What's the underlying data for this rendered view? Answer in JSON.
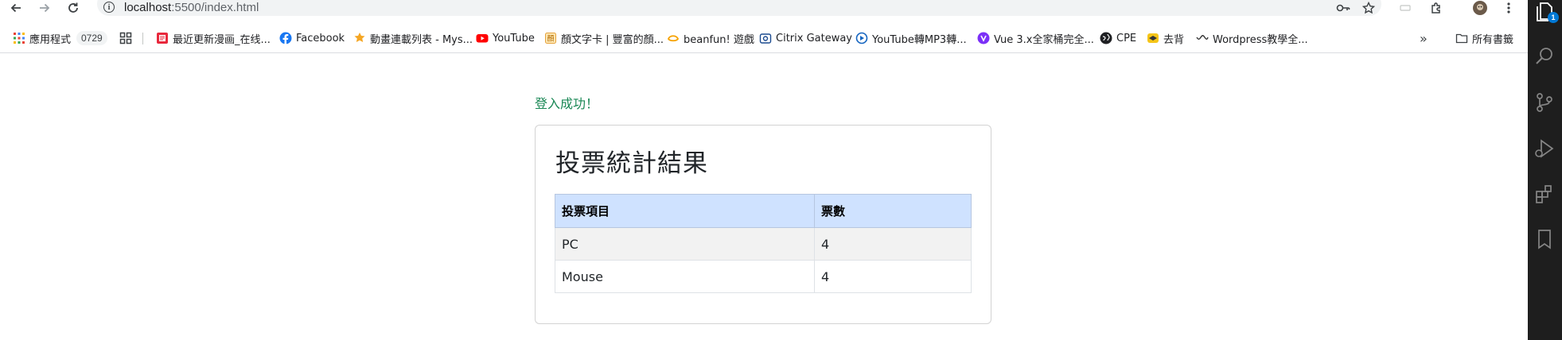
{
  "browser": {
    "url_host": "localhost",
    "url_path": ":5500/index.html",
    "back_icon": "arrow-left-icon",
    "forward_icon": "arrow-right-icon",
    "reload_icon": "reload-icon",
    "toolbar_icons": [
      "password-key-icon",
      "star-icon",
      "extensions-icon",
      "profile-avatar-icon",
      "more-menu-icon"
    ]
  },
  "bookmarks": {
    "apps_label": "應用程式",
    "badge": "0729",
    "items": [
      {
        "label": "最近更新漫画_在线...",
        "icon": "manga-icon"
      },
      {
        "label": "Facebook",
        "icon": "facebook-icon"
      },
      {
        "label": "動畫連載列表 - Mys...",
        "icon": "myself-icon"
      },
      {
        "label": "YouTube",
        "icon": "youtube-icon"
      },
      {
        "label": "顏文字卡 | 豐富的顏...",
        "icon": "kaomoji-icon"
      },
      {
        "label": "beanfun! 遊戲",
        "icon": "beanfun-icon"
      },
      {
        "label": "Citrix Gateway",
        "icon": "citrix-icon"
      },
      {
        "label": "YouTube轉MP3轉...",
        "icon": "ytmp3-icon"
      },
      {
        "label": "Vue 3.x全家桶完全...",
        "icon": "vue-course-icon"
      },
      {
        "label": "CPE",
        "icon": "globe-icon"
      },
      {
        "label": "去背",
        "icon": "removebg-icon"
      },
      {
        "label": "Wordpress教學全...",
        "icon": "wordpress-icon"
      }
    ],
    "overflow": "»",
    "all_bookmarks_label": "所有書籤"
  },
  "page": {
    "success_message": "登入成功！",
    "card_title": "投票統計結果",
    "table": {
      "headers": [
        "投票項目",
        "票數"
      ],
      "rows": [
        [
          "PC",
          "4"
        ],
        [
          "Mouse",
          "4"
        ]
      ]
    }
  },
  "vscode_activity": {
    "icons": [
      "explorer-icon",
      "search-icon",
      "source-control-icon",
      "run-debug-icon",
      "extensions-icon",
      "bookmark-icon"
    ],
    "explorer_badge": "1"
  },
  "colors": {
    "success": "#198754",
    "table_header_bg": "#cfe2ff",
    "activity_bar_bg": "#1e1e1e",
    "badge_blue": "#0078d4"
  }
}
